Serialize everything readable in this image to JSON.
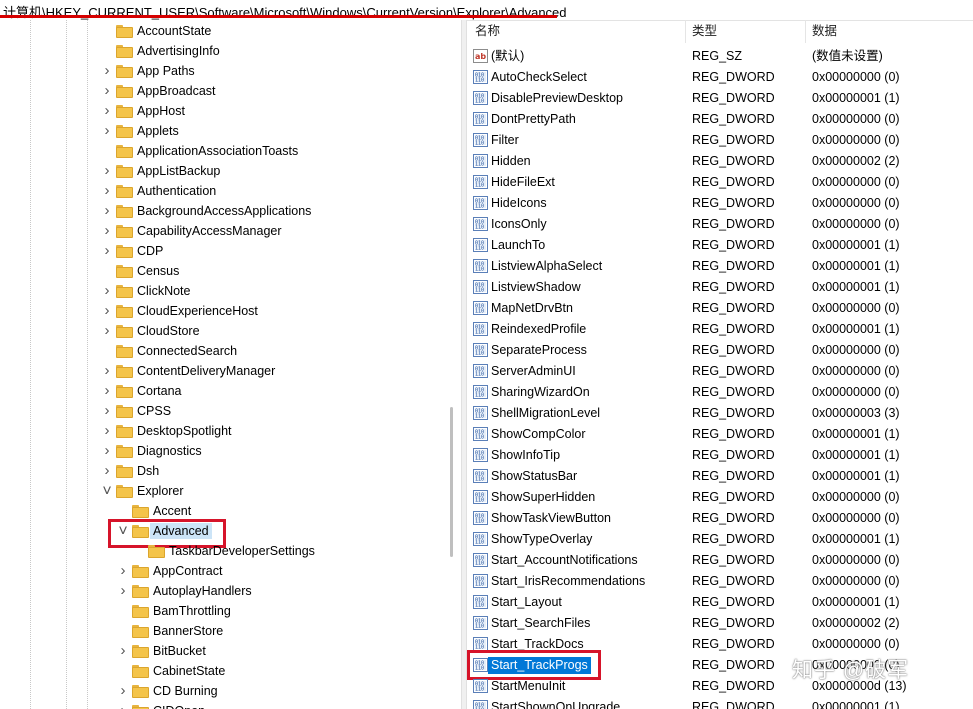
{
  "address_bar": {
    "path": "计算机\\HKEY_CURRENT_USER\\Software\\Microsoft\\Windows\\CurrentVersion\\Explorer\\Advanced"
  },
  "tree": {
    "items": [
      {
        "label": "AccountState",
        "level": 0,
        "expander": "none"
      },
      {
        "label": "AdvertisingInfo",
        "level": 0,
        "expander": "none"
      },
      {
        "label": "App Paths",
        "level": 0,
        "expander": "collapsed"
      },
      {
        "label": "AppBroadcast",
        "level": 0,
        "expander": "collapsed"
      },
      {
        "label": "AppHost",
        "level": 0,
        "expander": "collapsed"
      },
      {
        "label": "Applets",
        "level": 0,
        "expander": "collapsed"
      },
      {
        "label": "ApplicationAssociationToasts",
        "level": 0,
        "expander": "none"
      },
      {
        "label": "AppListBackup",
        "level": 0,
        "expander": "collapsed"
      },
      {
        "label": "Authentication",
        "level": 0,
        "expander": "collapsed"
      },
      {
        "label": "BackgroundAccessApplications",
        "level": 0,
        "expander": "collapsed"
      },
      {
        "label": "CapabilityAccessManager",
        "level": 0,
        "expander": "collapsed"
      },
      {
        "label": "CDP",
        "level": 0,
        "expander": "collapsed"
      },
      {
        "label": "Census",
        "level": 0,
        "expander": "none"
      },
      {
        "label": "ClickNote",
        "level": 0,
        "expander": "collapsed"
      },
      {
        "label": "CloudExperienceHost",
        "level": 0,
        "expander": "collapsed"
      },
      {
        "label": "CloudStore",
        "level": 0,
        "expander": "collapsed"
      },
      {
        "label": "ConnectedSearch",
        "level": 0,
        "expander": "none"
      },
      {
        "label": "ContentDeliveryManager",
        "level": 0,
        "expander": "collapsed"
      },
      {
        "label": "Cortana",
        "level": 0,
        "expander": "collapsed"
      },
      {
        "label": "CPSS",
        "level": 0,
        "expander": "collapsed"
      },
      {
        "label": "DesktopSpotlight",
        "level": 0,
        "expander": "collapsed"
      },
      {
        "label": "Diagnostics",
        "level": 0,
        "expander": "collapsed"
      },
      {
        "label": "Dsh",
        "level": 0,
        "expander": "collapsed"
      },
      {
        "label": "Explorer",
        "level": 0,
        "expander": "expanded"
      },
      {
        "label": "Accent",
        "level": 1,
        "expander": "none"
      },
      {
        "label": "Advanced",
        "level": 1,
        "expander": "expanded",
        "selected": true
      },
      {
        "label": "TaskbarDeveloperSettings",
        "level": 2,
        "expander": "none"
      },
      {
        "label": "AppContract",
        "level": 1,
        "expander": "collapsed"
      },
      {
        "label": "AutoplayHandlers",
        "level": 1,
        "expander": "collapsed"
      },
      {
        "label": "BamThrottling",
        "level": 1,
        "expander": "none"
      },
      {
        "label": "BannerStore",
        "level": 1,
        "expander": "none"
      },
      {
        "label": "BitBucket",
        "level": 1,
        "expander": "collapsed"
      },
      {
        "label": "CabinetState",
        "level": 1,
        "expander": "none"
      },
      {
        "label": "CD Burning",
        "level": 1,
        "expander": "collapsed"
      },
      {
        "label": "CIDOpen",
        "level": 1,
        "expander": "collapsed"
      }
    ]
  },
  "values": {
    "headers": {
      "name": "名称",
      "type": "类型",
      "data": "数据"
    },
    "rows": [
      {
        "name": "(默认)",
        "type": "REG_SZ",
        "data": "(数值未设置)",
        "icon": "string"
      },
      {
        "name": "AutoCheckSelect",
        "type": "REG_DWORD",
        "data": "0x00000000 (0)",
        "icon": "binary"
      },
      {
        "name": "DisablePreviewDesktop",
        "type": "REG_DWORD",
        "data": "0x00000001 (1)",
        "icon": "binary"
      },
      {
        "name": "DontPrettyPath",
        "type": "REG_DWORD",
        "data": "0x00000000 (0)",
        "icon": "binary"
      },
      {
        "name": "Filter",
        "type": "REG_DWORD",
        "data": "0x00000000 (0)",
        "icon": "binary"
      },
      {
        "name": "Hidden",
        "type": "REG_DWORD",
        "data": "0x00000002 (2)",
        "icon": "binary"
      },
      {
        "name": "HideFileExt",
        "type": "REG_DWORD",
        "data": "0x00000000 (0)",
        "icon": "binary"
      },
      {
        "name": "HideIcons",
        "type": "REG_DWORD",
        "data": "0x00000000 (0)",
        "icon": "binary"
      },
      {
        "name": "IconsOnly",
        "type": "REG_DWORD",
        "data": "0x00000000 (0)",
        "icon": "binary"
      },
      {
        "name": "LaunchTo",
        "type": "REG_DWORD",
        "data": "0x00000001 (1)",
        "icon": "binary"
      },
      {
        "name": "ListviewAlphaSelect",
        "type": "REG_DWORD",
        "data": "0x00000001 (1)",
        "icon": "binary"
      },
      {
        "name": "ListviewShadow",
        "type": "REG_DWORD",
        "data": "0x00000001 (1)",
        "icon": "binary"
      },
      {
        "name": "MapNetDrvBtn",
        "type": "REG_DWORD",
        "data": "0x00000000 (0)",
        "icon": "binary"
      },
      {
        "name": "ReindexedProfile",
        "type": "REG_DWORD",
        "data": "0x00000001 (1)",
        "icon": "binary"
      },
      {
        "name": "SeparateProcess",
        "type": "REG_DWORD",
        "data": "0x00000000 (0)",
        "icon": "binary"
      },
      {
        "name": "ServerAdminUI",
        "type": "REG_DWORD",
        "data": "0x00000000 (0)",
        "icon": "binary"
      },
      {
        "name": "SharingWizardOn",
        "type": "REG_DWORD",
        "data": "0x00000000 (0)",
        "icon": "binary"
      },
      {
        "name": "ShellMigrationLevel",
        "type": "REG_DWORD",
        "data": "0x00000003 (3)",
        "icon": "binary"
      },
      {
        "name": "ShowCompColor",
        "type": "REG_DWORD",
        "data": "0x00000001 (1)",
        "icon": "binary"
      },
      {
        "name": "ShowInfoTip",
        "type": "REG_DWORD",
        "data": "0x00000001 (1)",
        "icon": "binary"
      },
      {
        "name": "ShowStatusBar",
        "type": "REG_DWORD",
        "data": "0x00000001 (1)",
        "icon": "binary"
      },
      {
        "name": "ShowSuperHidden",
        "type": "REG_DWORD",
        "data": "0x00000000 (0)",
        "icon": "binary"
      },
      {
        "name": "ShowTaskViewButton",
        "type": "REG_DWORD",
        "data": "0x00000000 (0)",
        "icon": "binary"
      },
      {
        "name": "ShowTypeOverlay",
        "type": "REG_DWORD",
        "data": "0x00000001 (1)",
        "icon": "binary"
      },
      {
        "name": "Start_AccountNotifications",
        "type": "REG_DWORD",
        "data": "0x00000000 (0)",
        "icon": "binary"
      },
      {
        "name": "Start_IrisRecommendations",
        "type": "REG_DWORD",
        "data": "0x00000000 (0)",
        "icon": "binary"
      },
      {
        "name": "Start_Layout",
        "type": "REG_DWORD",
        "data": "0x00000001 (1)",
        "icon": "binary"
      },
      {
        "name": "Start_SearchFiles",
        "type": "REG_DWORD",
        "data": "0x00000002 (2)",
        "icon": "binary"
      },
      {
        "name": "Start_TrackDocs",
        "type": "REG_DWORD",
        "data": "0x00000000 (0)",
        "icon": "binary"
      },
      {
        "name": "Start_TrackProgs",
        "type": "REG_DWORD",
        "data": "0x00000000 (0)",
        "icon": "binary",
        "selected": true
      },
      {
        "name": "StartMenuInit",
        "type": "REG_DWORD",
        "data": "0x0000000d (13)",
        "icon": "binary"
      },
      {
        "name": "StartShownOnUpgrade",
        "type": "REG_DWORD",
        "data": "0x00000001 (1)",
        "icon": "binary"
      }
    ]
  },
  "watermark": {
    "text": "知乎 @破军"
  },
  "colors": {
    "highlight_red": "#d6142a",
    "selection_blue": "#0078d7",
    "folder_yellow": "#f4c44a"
  }
}
